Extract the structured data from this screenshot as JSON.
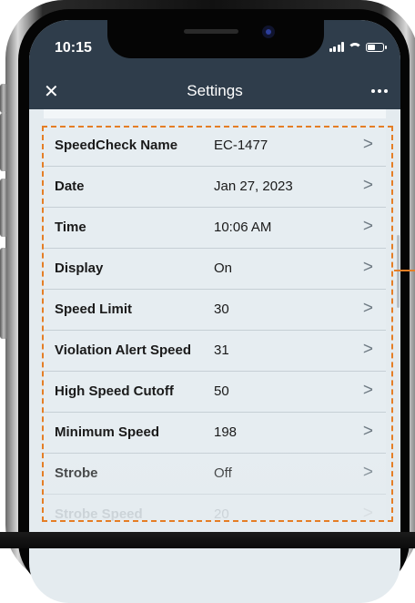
{
  "status_bar": {
    "time": "10:15"
  },
  "nav": {
    "title": "Settings",
    "close_icon": "close-icon",
    "more_icon": "more-icon"
  },
  "accent_color": "#e57e25",
  "settings": [
    {
      "label": "SpeedCheck Name",
      "value": "EC-1477"
    },
    {
      "label": "Date",
      "value": "Jan 27, 2023"
    },
    {
      "label": "Time",
      "value": "10:06 AM"
    },
    {
      "label": "Display",
      "value": "On"
    },
    {
      "label": "Speed Limit",
      "value": "30"
    },
    {
      "label": "Violation Alert Speed",
      "value": "31"
    },
    {
      "label": "High Speed Cutoff",
      "value": "50"
    },
    {
      "label": "Minimum Speed",
      "value": "198"
    },
    {
      "label": "Strobe",
      "value": "Off"
    },
    {
      "label": "Strobe Speed",
      "value": "20"
    }
  ],
  "chevron_glyph": ">"
}
